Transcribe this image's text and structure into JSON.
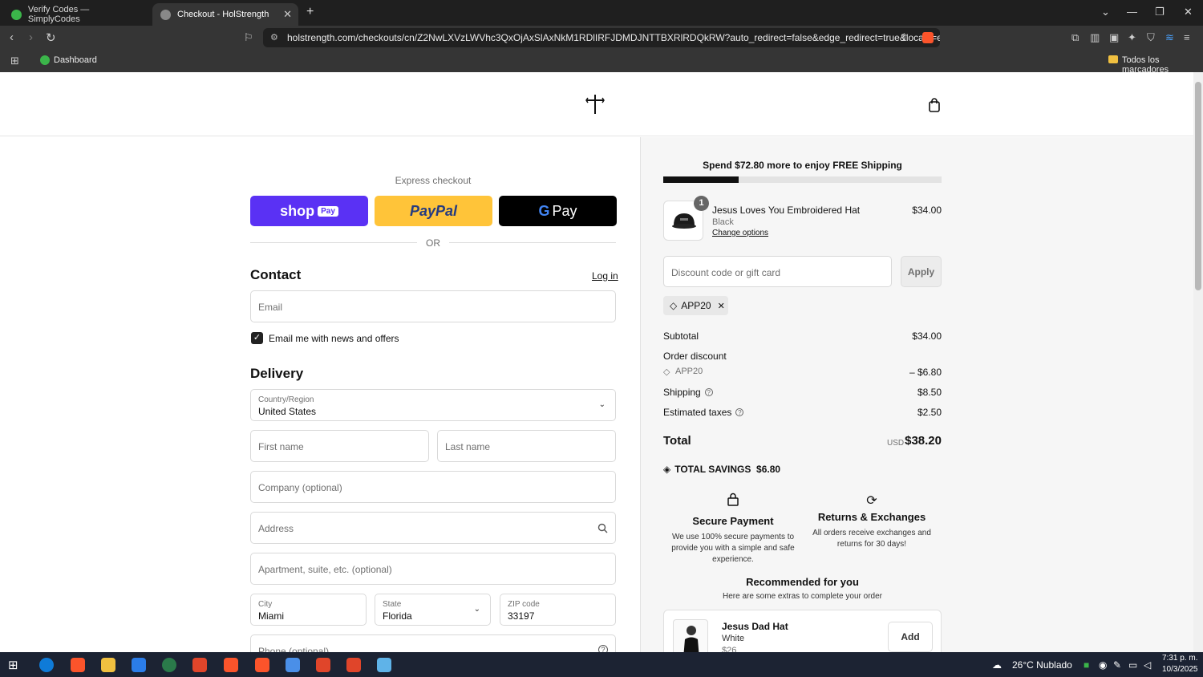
{
  "browser": {
    "tabs": [
      {
        "title": "Verify Codes — SimplyCodes",
        "active": false
      },
      {
        "title": "Checkout - HolStrength",
        "active": true
      }
    ],
    "url": "holstrength.com/checkouts/cn/Z2NwLXVzLWVhc3QxOjAxSlAxNkM1RDlIRFJDMDJNTTBXRlRDQkRW?auto_redirect=false&edge_redirect=true&locale=en-...",
    "bookmark_dashboard": "Dashboard",
    "bookmark_all": "Todos los marcadores",
    "brave_badge": "7"
  },
  "checkout": {
    "express_label": "Express checkout",
    "shop_pay_label": "shop",
    "shop_pay_badge": "Pay",
    "paypal_label": "PayPal",
    "gpay_label": "Pay",
    "or_label": "OR",
    "contact_title": "Contact",
    "login_link": "Log in",
    "email_placeholder": "Email",
    "news_label": "Email me with news and offers",
    "news_checked": true,
    "delivery_title": "Delivery",
    "country_label": "Country/Region",
    "country_value": "United States",
    "first_name_placeholder": "First name",
    "last_name_placeholder": "Last name",
    "company_placeholder": "Company (optional)",
    "address_placeholder": "Address",
    "apartment_placeholder": "Apartment, suite, etc. (optional)",
    "city_label": "City",
    "city_value": "Miami",
    "state_label": "State",
    "state_value": "Florida",
    "zip_label": "ZIP code",
    "zip_value": "33197",
    "phone_placeholder": "Phone (optional)"
  },
  "summary": {
    "shipping_message": "Spend $72.80 more to enjoy FREE Shipping",
    "shipping_progress": 0.27,
    "item": {
      "qty": "1",
      "name": "Jesus Loves You Embroidered Hat",
      "variant": "Black",
      "change_link": "Change options",
      "price": "$34.00"
    },
    "discount_placeholder": "Discount code or gift card",
    "apply_label": "Apply",
    "applied_code": "APP20",
    "subtotal_label": "Subtotal",
    "subtotal_value": "$34.00",
    "order_discount_label": "Order discount",
    "discount_code": "APP20",
    "discount_value": "– $6.80",
    "shipping_label": "Shipping",
    "shipping_value": "$8.50",
    "taxes_label": "Estimated taxes",
    "taxes_value": "$2.50",
    "total_label": "Total",
    "currency": "USD",
    "total_value": "$38.20",
    "savings_label": "TOTAL SAVINGS",
    "savings_value": "$6.80",
    "secure_title": "Secure Payment",
    "secure_desc": "We use 100% secure payments to provide you with a simple and safe experience.",
    "returns_title": "Returns & Exchanges",
    "returns_desc": "All orders receive exchanges and returns for 30 days!",
    "rec_title": "Recommended for you",
    "rec_subtitle": "Here are some extras to complete your order",
    "rec_item_name": "Jesus Dad Hat",
    "rec_item_variant": "White",
    "rec_item_price": "$26",
    "add_label": "Add"
  },
  "taskbar": {
    "weather": "26°C  Nublado",
    "time": "7:31 p. m.",
    "date": "10/3/2025"
  },
  "colors": {
    "shop_pay": "#5a31f4",
    "paypal": "#ffc439",
    "gpay": "#000000"
  }
}
